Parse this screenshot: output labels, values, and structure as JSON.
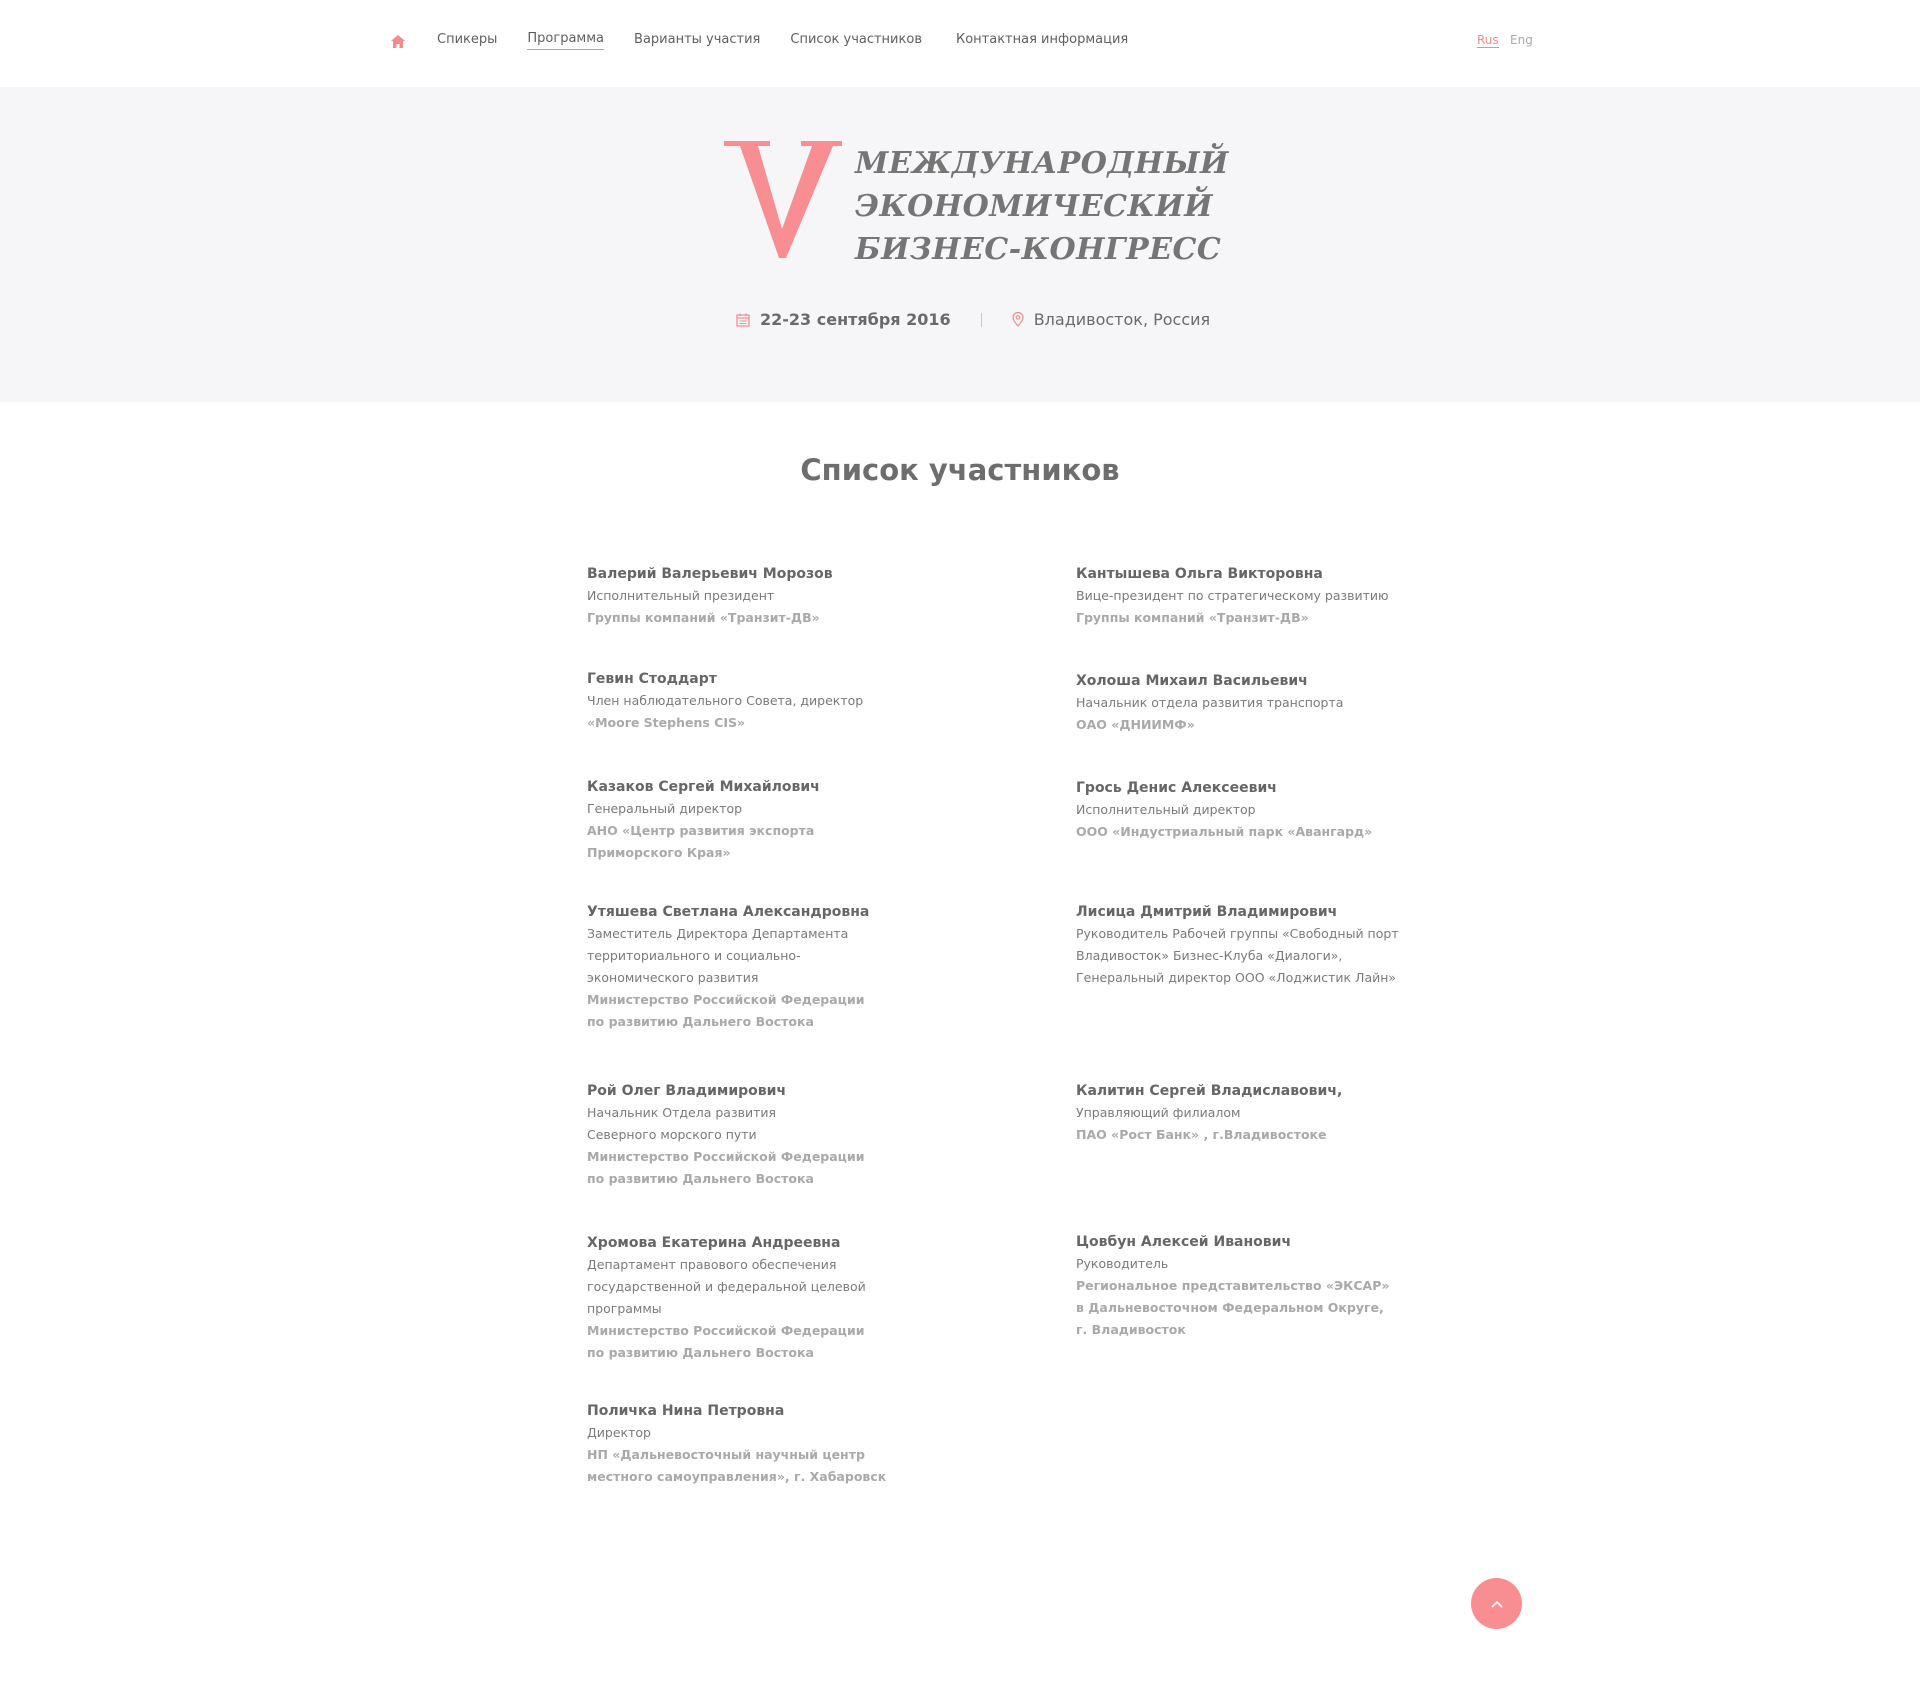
{
  "nav": {
    "items": [
      {
        "label": "Спикеры"
      },
      {
        "label": "Программа"
      },
      {
        "label": "Варианты участия"
      },
      {
        "label": "Список участников"
      },
      {
        "label": "Контактная информация"
      }
    ],
    "lang_rus": "Rus",
    "lang_eng": "Eng"
  },
  "hero": {
    "numeral": "V",
    "title": [
      "МЕЖДУНАРОДНЫЙ",
      "ЭКОНОМИЧЕСКИЙ",
      "БИЗНЕС-КОНГРЕСС"
    ],
    "date": "22-23 сентября 2016",
    "place": "Владивосток, Россия"
  },
  "main": {
    "title": "Список участников",
    "participants": [
      {
        "name": "Валерий Валерьевич Морозов",
        "lines": [
          "Исполнительный президент"
        ],
        "org": [
          "Группы компаний «Транзит-ДВ»"
        ]
      },
      {
        "name": "Кантышева Ольга Викторовна",
        "lines": [
          "Вице-президент по стратегическому развитию"
        ],
        "org": [
          "Группы компаний «Транзит-ДВ»"
        ]
      },
      {
        "name": "Гевин Стоддарт",
        "lines": [
          "Член наблюдательного Совета, директор"
        ],
        "org": [
          "«Moore Stephens CIS»"
        ]
      },
      {
        "name": "Холоша Михаил Васильевич",
        "lines": [
          "Начальник отдела развития транспорта"
        ],
        "org": [
          "ОАО «ДНИИМФ»"
        ]
      },
      {
        "name": "Казаков Сергей Михайлович",
        "lines": [
          "Генеральный директор"
        ],
        "org": [
          "АНО «Центр развития экспорта",
          "Приморского Края»"
        ]
      },
      {
        "name": "Грось Денис Алексеевич",
        "lines": [
          "Исполнительный директор"
        ],
        "org": [
          "ООО «Индустриальный парк «Авангард»"
        ]
      },
      {
        "name": "Утяшева Светлана Александровна",
        "lines": [
          "Заместитель Директора Департамента",
          "территориального и социально-",
          "экономического развития"
        ],
        "org": [
          "Министерство Российской Федерации",
          "по развитию Дальнего Востока"
        ]
      },
      {
        "name": "Лисица Дмитрий Владимирович",
        "lines": [
          "Руководитель Рабочей группы «Свободный порт",
          "Владивосток» Бизнес-Клуба «Диалоги»,",
          "Генеральный директор ООО «Лоджистик Лайн»"
        ],
        "org": []
      },
      {
        "name": "Рой Олег Владимирович",
        "lines": [
          "Начальник Отдела развития",
          "Северного морского пути"
        ],
        "org": [
          "Министерство Российской Федерации",
          "по развитию Дальнего Востока"
        ]
      },
      {
        "name": "Калитин Сергей Владиславович,",
        "lines": [
          "Управляющий филиалом"
        ],
        "org": [
          "ПАО «Рост Банк» , г.Владивостоке"
        ]
      },
      {
        "name": "Хромова Екатерина Андреевна",
        "lines": [
          "Департамент правового обеспечения",
          "государственной и федеральной целевой",
          "программы"
        ],
        "org": [
          "Министерство Российской Федерации",
          "по развитию Дальнего Востока"
        ]
      },
      {
        "name": "Цовбун Алексей Иванович",
        "lines": [
          "Руководитель"
        ],
        "org": [
          "Региональное представительство «ЭКСАР»",
          "в Дальневосточном Федеральном Округе,",
          "г. Владивосток"
        ]
      },
      {
        "name": "Поличка Нина Петровна",
        "lines": [
          "Директор"
        ],
        "org": [
          "НП «Дальневосточный научный центр",
          "местного самоуправления», г. Хабаровск"
        ]
      }
    ]
  },
  "colors": {
    "accent": "#f98e92",
    "hero_bg": "#f6f6f8",
    "text": "#666666",
    "org_text": "#a9a9a9"
  },
  "icons": {
    "home": "home-icon",
    "calendar": "calendar-icon",
    "location": "location-pin-icon",
    "scroll_top": "chevron-up-icon"
  }
}
